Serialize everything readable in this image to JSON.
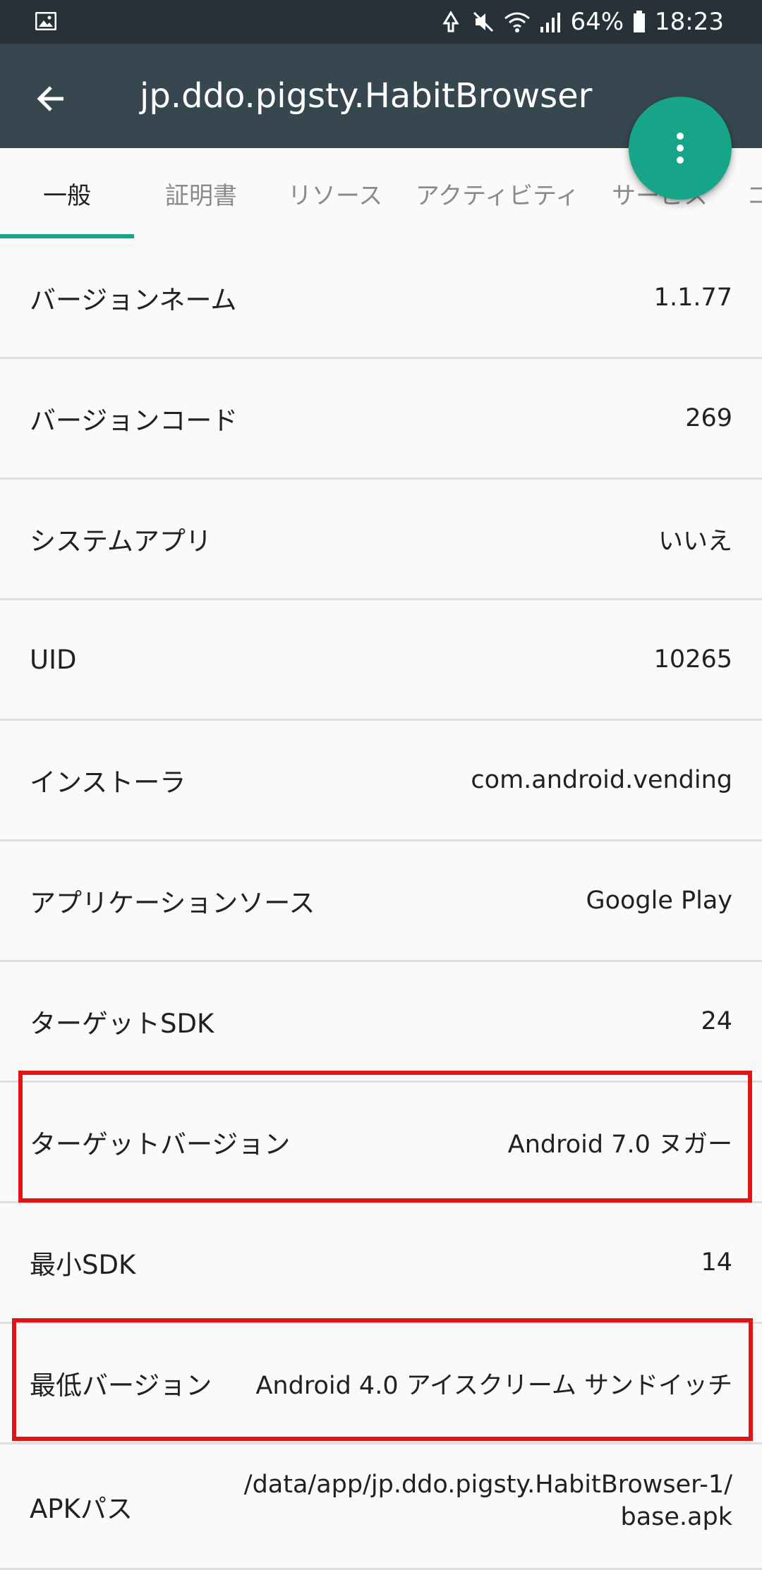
{
  "status_bar": {
    "battery": "64%",
    "time": "18:23",
    "icons": [
      "image-icon",
      "data-saver-icon",
      "mute-icon",
      "wifi-icon",
      "signal-icon",
      "battery-icon"
    ]
  },
  "app_bar": {
    "title": "jp.ddo.pigsty.HabitBrowser",
    "back_icon": "arrow-back-icon",
    "menu_icon": "more-vert-icon"
  },
  "tabs": [
    {
      "label": "一般",
      "active": true
    },
    {
      "label": "証明書",
      "active": false
    },
    {
      "label": "リソース",
      "active": false
    },
    {
      "label": "アクティビティ",
      "active": false
    },
    {
      "label": "サービス",
      "active": false
    },
    {
      "label": "コ",
      "active": false
    }
  ],
  "rows": [
    {
      "label": "バージョンネーム",
      "value": "1.1.77"
    },
    {
      "label": "バージョンコード",
      "value": "269"
    },
    {
      "label": "システムアプリ",
      "value": "いいえ"
    },
    {
      "label": "UID",
      "value": "10265"
    },
    {
      "label": "インストーラ",
      "value": "com.android.vending"
    },
    {
      "label": "アプリケーションソース",
      "value": "Google Play"
    },
    {
      "label": "ターゲットSDK",
      "value": "24"
    },
    {
      "label": "ターゲットバージョン",
      "value": "Android 7.0 ヌガー"
    },
    {
      "label": "最小SDK",
      "value": "14"
    },
    {
      "label": "最低バージョン",
      "value": "Android 4.0 アイスクリーム サンドイッチ"
    },
    {
      "label": "APKパス",
      "value": "/data/app/jp.ddo.pigsty.HabitBrowser-1/base.apk"
    }
  ],
  "colors": {
    "status_bar": "#263238",
    "app_bar": "#37474f",
    "accent": "#17a58a",
    "highlight": "#e01414"
  }
}
